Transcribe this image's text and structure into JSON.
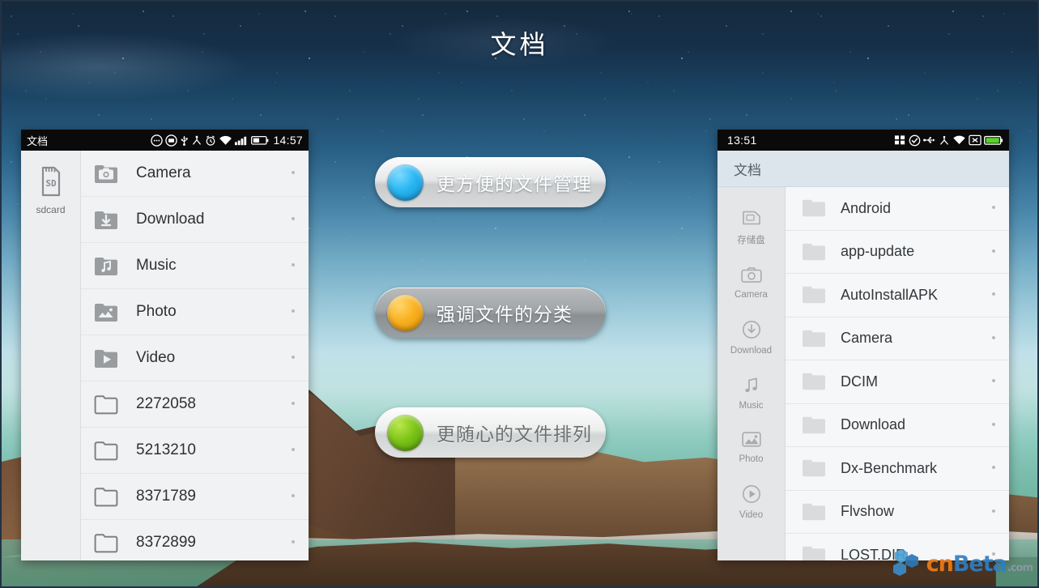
{
  "page": {
    "title": "文档",
    "watermark": {
      "part1": "cn",
      "part2": "Beta",
      "part3": ".com"
    }
  },
  "features": [
    {
      "label": "更方便的文件管理",
      "dot_color": "#29b6f2",
      "dot_name": "blue-dot"
    },
    {
      "label": "强调文件的分类",
      "dot_color": "#f9b121",
      "dot_name": "orange-dot"
    },
    {
      "label": "更随心的文件排列",
      "dot_color": "#7dc418",
      "dot_name": "green-dot"
    }
  ],
  "phone_left": {
    "statusbar": {
      "title": "文档",
      "time": "14:57",
      "icons": [
        "message-icon",
        "screenshot-icon",
        "usb-icon",
        "sync-icon",
        "alarm-icon",
        "wifi-icon",
        "signal-icon",
        "battery-icon"
      ]
    },
    "sidebar": [
      {
        "label": "sdcard",
        "icon": "sdcard-icon"
      }
    ],
    "files": [
      {
        "name": "Camera",
        "icon": "camera-folder-icon"
      },
      {
        "name": "Download",
        "icon": "download-folder-icon"
      },
      {
        "name": "Music",
        "icon": "music-folder-icon"
      },
      {
        "name": "Photo",
        "icon": "photo-folder-icon"
      },
      {
        "name": "Video",
        "icon": "video-folder-icon"
      },
      {
        "name": "2272058",
        "icon": "folder-icon"
      },
      {
        "name": "5213210",
        "icon": "folder-icon"
      },
      {
        "name": "8371789",
        "icon": "folder-icon"
      },
      {
        "name": "8372899",
        "icon": "folder-icon"
      }
    ],
    "more_glyph": "•"
  },
  "phone_right": {
    "statusbar": {
      "time": "13:51",
      "icons": [
        "grid-icon",
        "check-circle-icon",
        "usb-icon",
        "sync-icon",
        "wifi-icon",
        "no-signal-icon",
        "battery-icon"
      ]
    },
    "header": {
      "title": "文档"
    },
    "sidebar": [
      {
        "label": "存储盘",
        "icon": "storage-icon"
      },
      {
        "label": "Camera",
        "icon": "camera-icon"
      },
      {
        "label": "Download",
        "icon": "download-icon"
      },
      {
        "label": "Music",
        "icon": "music-icon"
      },
      {
        "label": "Photo",
        "icon": "photo-icon"
      },
      {
        "label": "Video",
        "icon": "video-icon"
      }
    ],
    "files": [
      {
        "name": "Android",
        "icon": "folder-icon"
      },
      {
        "name": "app-update",
        "icon": "folder-icon"
      },
      {
        "name": "AutoInstallAPK",
        "icon": "folder-icon"
      },
      {
        "name": "Camera",
        "icon": "folder-icon"
      },
      {
        "name": "DCIM",
        "icon": "folder-icon"
      },
      {
        "name": "Download",
        "icon": "folder-icon"
      },
      {
        "name": "Dx-Benchmark",
        "icon": "folder-icon"
      },
      {
        "name": "Flvshow",
        "icon": "folder-icon"
      },
      {
        "name": "LOST.DIR",
        "icon": "folder-icon"
      }
    ],
    "more_glyph": "•"
  }
}
